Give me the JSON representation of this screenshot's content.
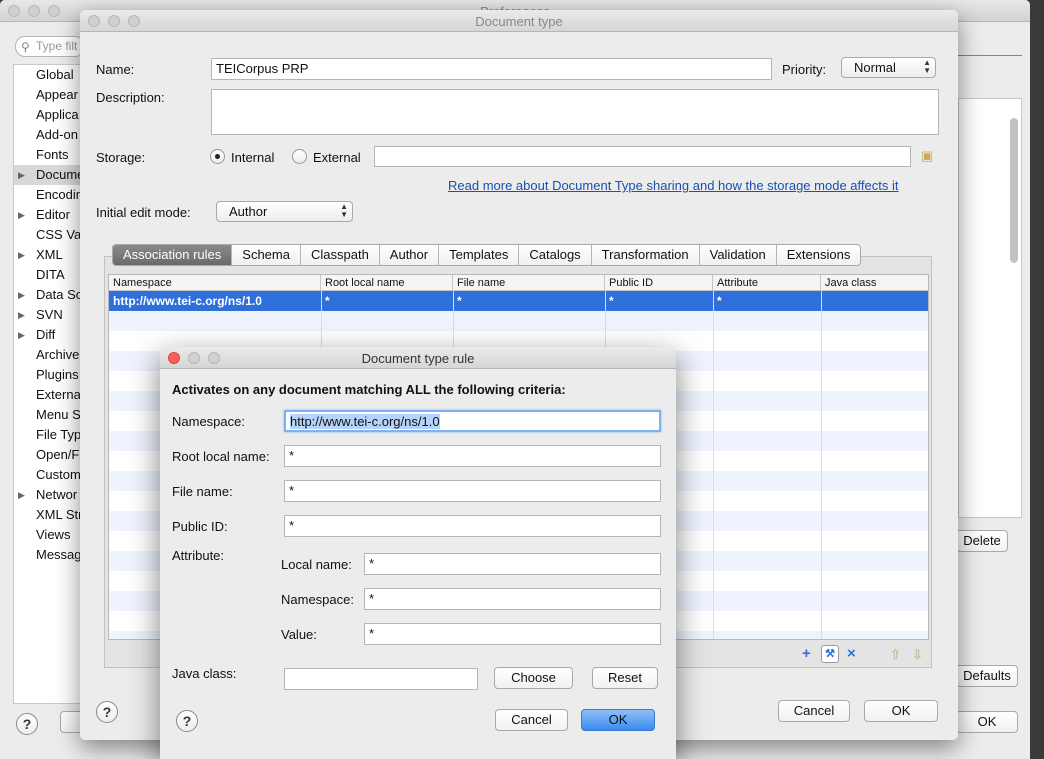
{
  "prefs": {
    "title": "Preferences",
    "filter_placeholder": "Type filt",
    "tree": [
      {
        "label": "Global",
        "arrow": false
      },
      {
        "label": "Appear",
        "arrow": false
      },
      {
        "label": "Applica",
        "arrow": false
      },
      {
        "label": "Add-on",
        "arrow": false
      },
      {
        "label": "Fonts",
        "arrow": false
      },
      {
        "label": "Docume",
        "arrow": true,
        "selected": true
      },
      {
        "label": "Encodin",
        "arrow": false
      },
      {
        "label": "Editor",
        "arrow": true
      },
      {
        "label": "CSS Val",
        "arrow": false
      },
      {
        "label": "XML",
        "arrow": true
      },
      {
        "label": "DITA",
        "arrow": false
      },
      {
        "label": "Data So",
        "arrow": true
      },
      {
        "label": "SVN",
        "arrow": true
      },
      {
        "label": "Diff",
        "arrow": true
      },
      {
        "label": "Archive",
        "arrow": false
      },
      {
        "label": "Plugins",
        "arrow": false
      },
      {
        "label": "Externa",
        "arrow": false
      },
      {
        "label": "Menu Sh",
        "arrow": false
      },
      {
        "label": "File Typ",
        "arrow": false
      },
      {
        "label": "Open/F",
        "arrow": false
      },
      {
        "label": "Custom",
        "arrow": false
      },
      {
        "label": "Networ",
        "arrow": true
      },
      {
        "label": "XML Str",
        "arrow": false
      },
      {
        "label": "Views",
        "arrow": false
      },
      {
        "label": "Messag",
        "arrow": false
      }
    ],
    "delete_label": "Delete",
    "defaults_label": "Defaults",
    "ok_label": "OK"
  },
  "doctype": {
    "title": "Document type",
    "name_label": "Name:",
    "name_value": "TEICorpus PRP",
    "priority_label": "Priority:",
    "priority_value": "Normal",
    "description_label": "Description:",
    "storage_label": "Storage:",
    "internal_label": "Internal",
    "external_label": "External",
    "storage_path": "",
    "read_more_link": "Read more about Document Type sharing and how the storage mode affects it",
    "edit_mode_label": "Initial edit mode:",
    "edit_mode_value": "Author",
    "tabs": [
      "Association rules",
      "Schema",
      "Classpath",
      "Author",
      "Templates",
      "Catalogs",
      "Transformation",
      "Validation",
      "Extensions"
    ],
    "columns": [
      "Namespace",
      "Root local name",
      "File name",
      "Public ID",
      "Attribute",
      "Java class"
    ],
    "rows": [
      {
        "namespace": "http://www.tei-c.org/ns/1.0",
        "root": "*",
        "file": "*",
        "public_id": "*",
        "attribute": "*",
        "java_class": ""
      }
    ],
    "cancel_label": "Cancel",
    "ok_label": "OK"
  },
  "rule": {
    "title": "Document type rule",
    "heading": "Activates on any document matching ALL the following criteria:",
    "namespace_label": "Namespace:",
    "namespace_value": "http://www.tei-c.org/ns/1.0",
    "root_label": "Root local name:",
    "root_value": "*",
    "file_label": "File name:",
    "file_value": "*",
    "public_id_label": "Public ID:",
    "public_id_value": "*",
    "attribute_label": "Attribute:",
    "local_name_label": "Local name:",
    "local_name_value": "*",
    "attr_ns_label": "Namespace:",
    "attr_ns_value": "*",
    "value_label": "Value:",
    "value_value": "*",
    "java_class_label": "Java class:",
    "java_class_value": "",
    "choose_label": "Choose",
    "reset_label": "Reset",
    "cancel_label": "Cancel",
    "ok_label": "OK"
  },
  "icons": {
    "help": "?",
    "add": "+",
    "edit": "wrench",
    "remove": "×",
    "up": "⇧",
    "down": "⇩"
  }
}
